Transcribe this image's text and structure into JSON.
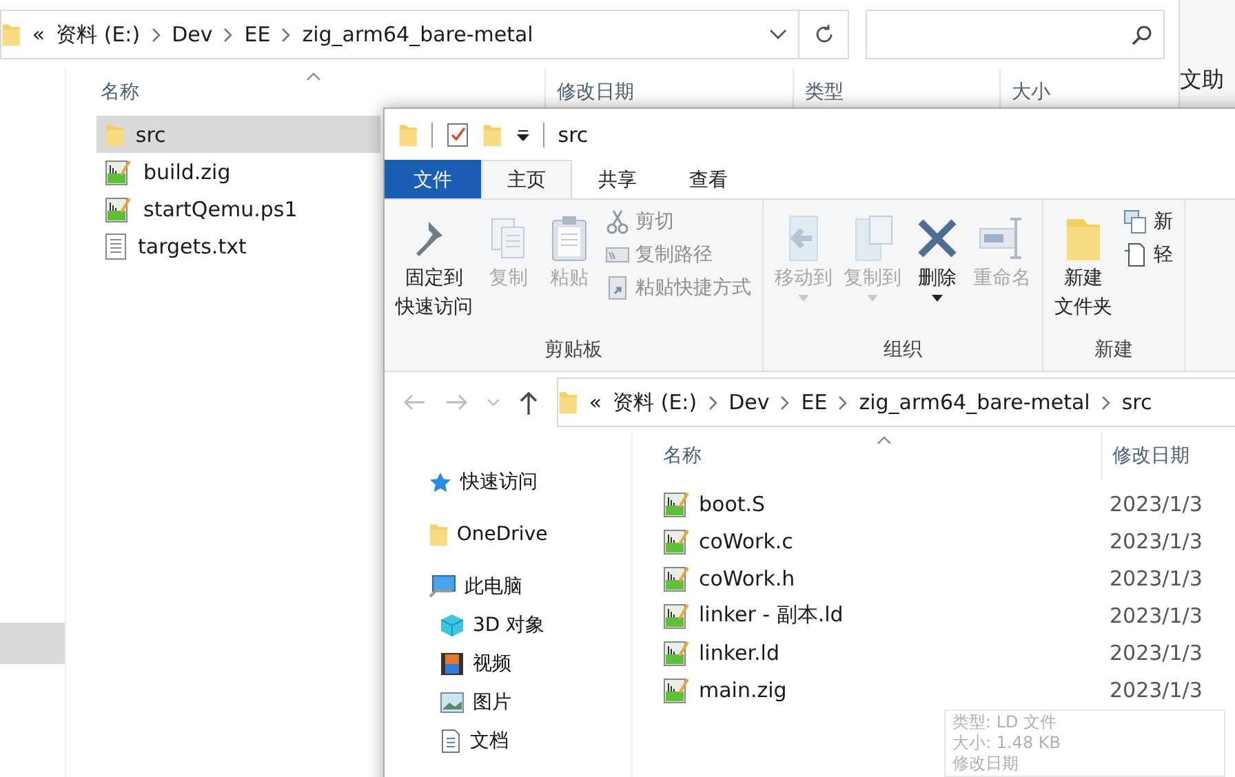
{
  "back_window": {
    "address": {
      "overflow": "«",
      "path": [
        "资料 (E:)",
        "Dev",
        "EE",
        "zig_arm64_bare-metal"
      ]
    },
    "columns": [
      "名称",
      "修改日期",
      "类型",
      "大小"
    ],
    "files": [
      {
        "name": "src",
        "kind": "folder",
        "selected": true
      },
      {
        "name": "build.zig",
        "kind": "script",
        "selected": false
      },
      {
        "name": "startQemu.ps1",
        "kind": "script",
        "selected": false
      },
      {
        "name": "targets.txt",
        "kind": "text",
        "selected": false
      }
    ]
  },
  "side_window": {
    "texts": [
      "文助"
    ]
  },
  "front_window": {
    "title": "src",
    "tabs": [
      {
        "label": "文件",
        "kind": "file",
        "selected": false
      },
      {
        "label": "主页",
        "kind": "tab",
        "selected": true
      },
      {
        "label": "共享",
        "kind": "tab",
        "selected": false
      },
      {
        "label": "查看",
        "kind": "tab",
        "selected": false
      }
    ],
    "ribbon_groups": [
      {
        "label": "剪贴板",
        "items": [
          {
            "lines": [
              "固定到",
              "快速访问"
            ],
            "kind": "large",
            "disabled": false
          },
          {
            "lines": [
              "复制"
            ],
            "kind": "large",
            "disabled": true
          },
          {
            "lines": [
              "粘贴"
            ],
            "kind": "large",
            "disabled": true
          },
          {
            "lines": [
              "剪切"
            ],
            "kind": "small",
            "disabled": true
          },
          {
            "lines": [
              "复制路径"
            ],
            "kind": "small",
            "disabled": true
          },
          {
            "lines": [
              "粘贴快捷方式"
            ],
            "kind": "small",
            "disabled": true
          }
        ]
      },
      {
        "label": "组织",
        "items": [
          {
            "lines": [
              "移动到"
            ],
            "kind": "large",
            "disabled": true,
            "menu": true
          },
          {
            "lines": [
              "复制到"
            ],
            "kind": "large",
            "disabled": true,
            "menu": true
          },
          {
            "lines": [
              "删除"
            ],
            "kind": "large",
            "disabled": false,
            "menu": true
          },
          {
            "lines": [
              "重命名"
            ],
            "kind": "large",
            "disabled": true
          }
        ]
      },
      {
        "label": "新建",
        "items": [
          {
            "lines": [
              "新建",
              "文件夹"
            ],
            "kind": "large",
            "disabled": false
          },
          {
            "lines": [
              "新"
            ],
            "kind": "small",
            "disabled": false
          },
          {
            "lines": [
              "轻"
            ],
            "kind": "small",
            "disabled": false
          }
        ]
      }
    ],
    "address": {
      "overflow": "«",
      "path": [
        "资料 (E:)",
        "Dev",
        "EE",
        "zig_arm64_bare-metal",
        "src"
      ]
    },
    "nav": [
      {
        "label": "快速访问",
        "kind": "star"
      },
      {
        "label": "OneDrive",
        "kind": "folder"
      },
      {
        "label": "此电脑",
        "kind": "pc",
        "children": [
          {
            "label": "3D 对象",
            "kind": "cube"
          },
          {
            "label": "视频",
            "kind": "video"
          },
          {
            "label": "图片",
            "kind": "picture"
          },
          {
            "label": "文档",
            "kind": "document"
          }
        ]
      }
    ],
    "columns": [
      "名称",
      "修改日期"
    ],
    "files": [
      {
        "name": "boot.S",
        "date": "2023/1/3"
      },
      {
        "name": "coWork.c",
        "date": "2023/1/3"
      },
      {
        "name": "coWork.h",
        "date": "2023/1/3"
      },
      {
        "name": "linker - 副本.ld",
        "date": "2023/1/3"
      },
      {
        "name": "linker.ld",
        "date": "2023/1/3"
      },
      {
        "name": "main.zig",
        "date": "2023/1/3"
      }
    ],
    "tooltip": [
      "类型: LD 文件",
      "大小: 1.48 KB",
      "修改日期"
    ]
  }
}
